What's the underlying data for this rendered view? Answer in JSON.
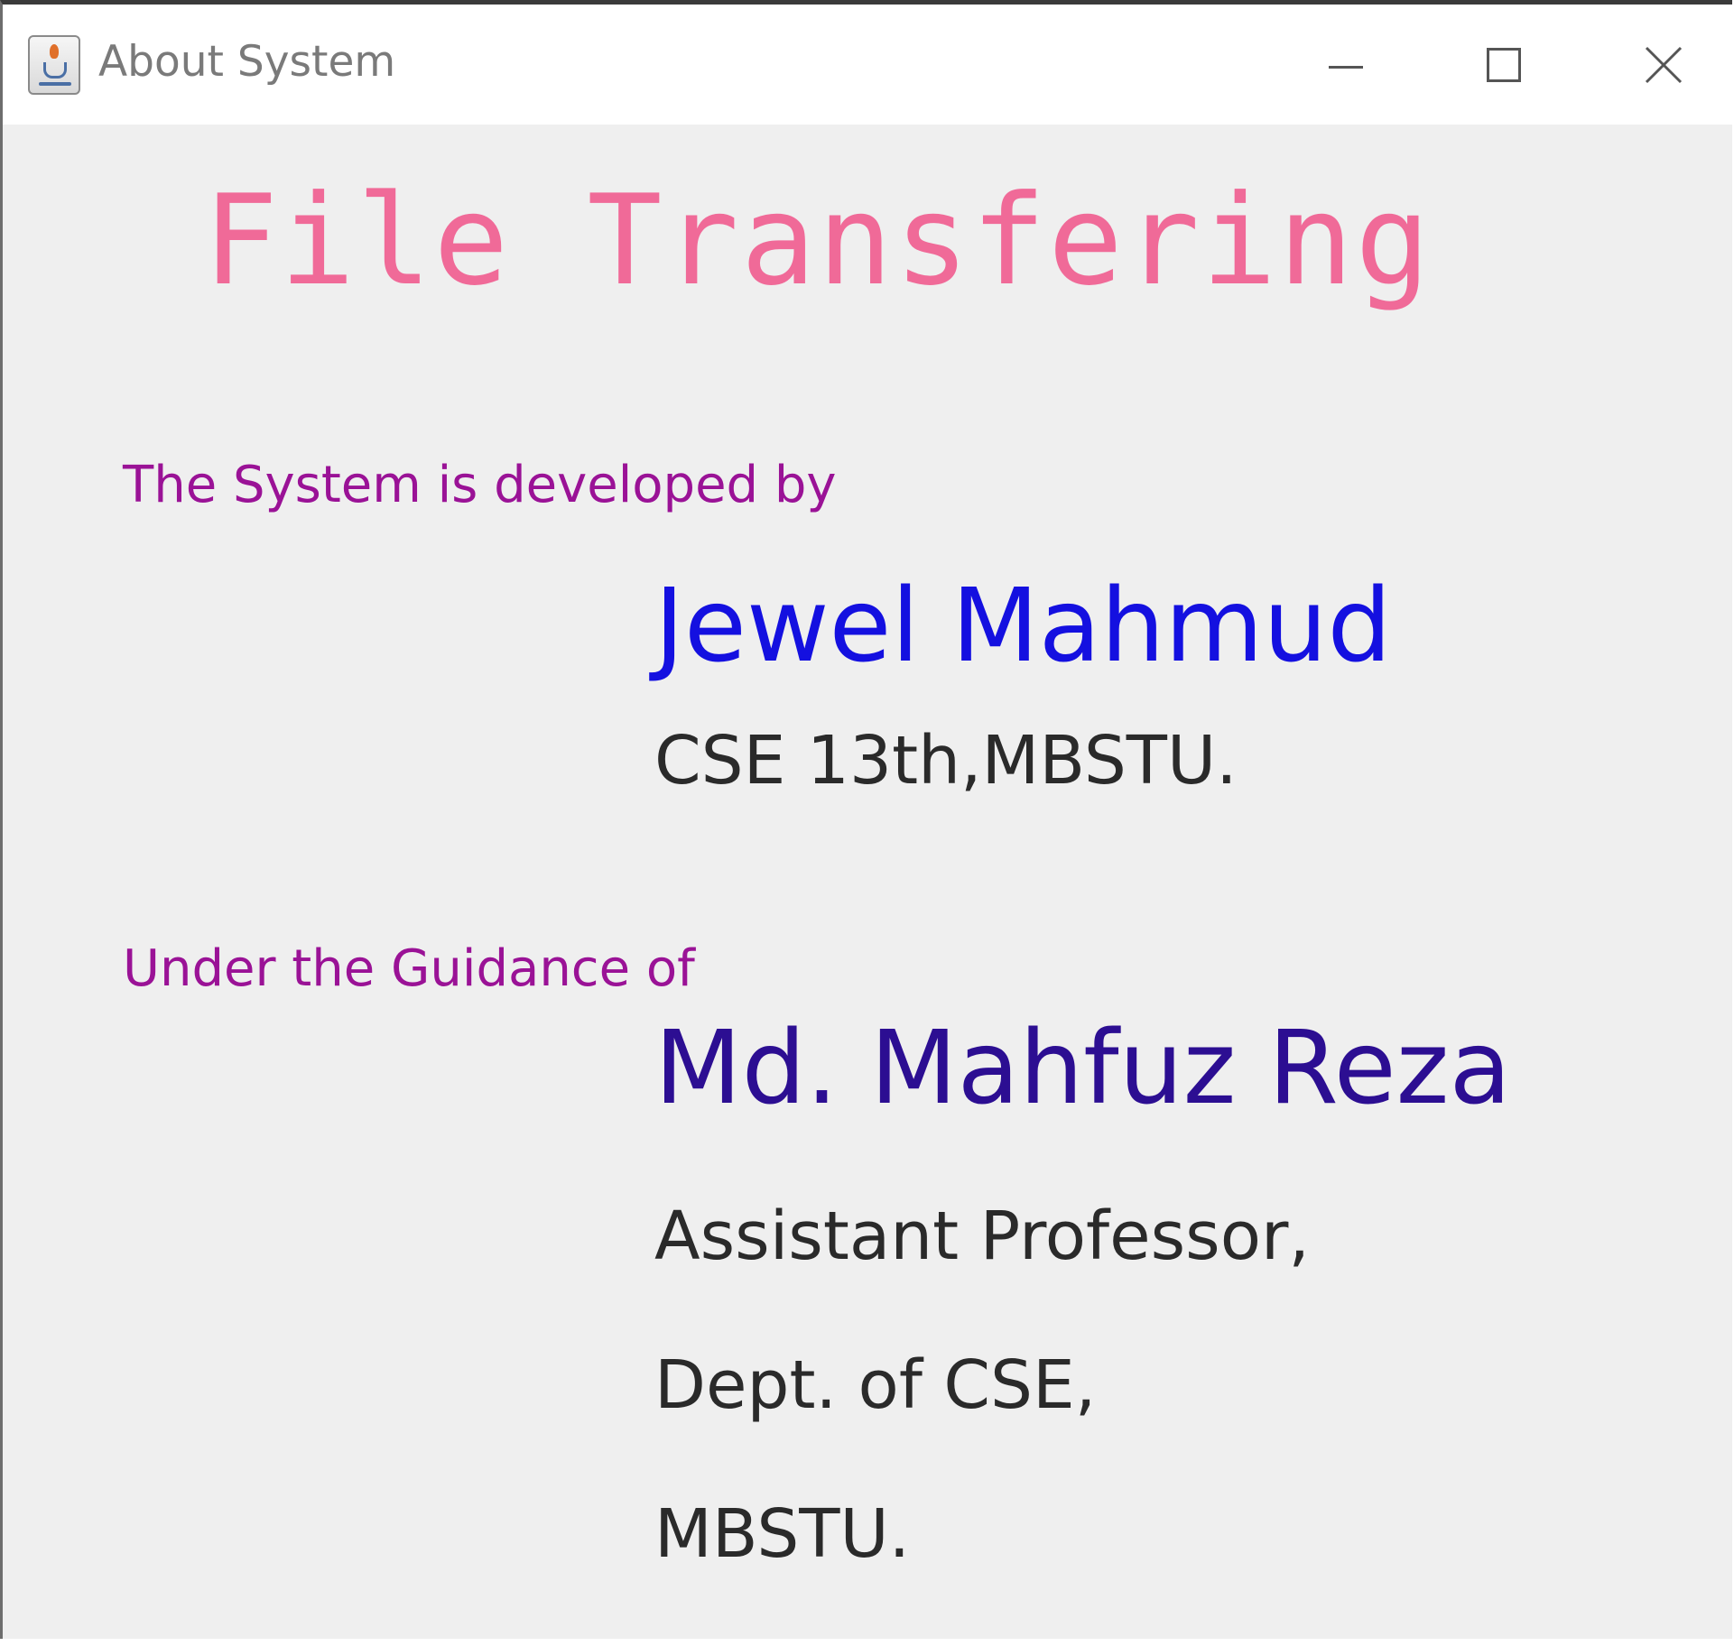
{
  "window": {
    "title": "About System",
    "icon": "java-cup-icon"
  },
  "controls": {
    "minimize_icon": "minimize-icon",
    "maximize_icon": "maximize-icon",
    "close_icon": "close-icon"
  },
  "content": {
    "headline": "File Transfering",
    "developer_label": "The System is developed by",
    "developer_name": "Jewel Mahmud",
    "developer_affiliation": "CSE 13th,MBSTU.",
    "guidance_label": "Under the Guidance of",
    "guide_name": "Md. Mahfuz Reza",
    "guide_designation": "Assistant Professor,",
    "guide_department": "Dept. of CSE,",
    "guide_institution": "MBSTU."
  },
  "colors": {
    "headline": "#f06a98",
    "labels": "#9a1296",
    "developer_name": "#1410e0",
    "guide_name": "#2c0e92",
    "body_text": "#2a2a2a",
    "background": "#efefef"
  }
}
